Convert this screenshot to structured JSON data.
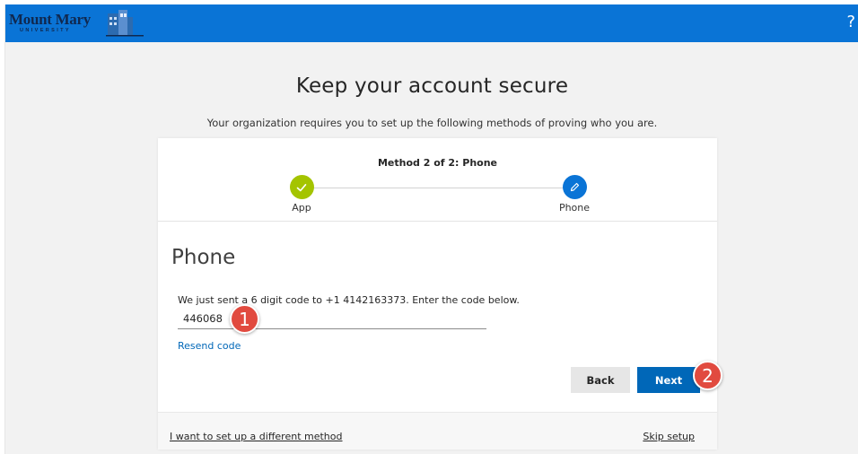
{
  "header": {
    "logo_text": "Mount Mary",
    "logo_subtext": "UNIVERSITY",
    "help_label": "?"
  },
  "page": {
    "title": "Keep your account secure",
    "subtitle": "Your organization requires you to set up the following methods of proving who you are."
  },
  "progress": {
    "method_label": "Method 2 of 2: Phone",
    "steps": [
      {
        "label": "App",
        "status": "complete",
        "color": "#a4c400",
        "icon": "checkmark-icon"
      },
      {
        "label": "Phone",
        "status": "current",
        "color": "#0a74d6",
        "icon": "pencil-icon"
      }
    ]
  },
  "phone_section": {
    "title": "Phone",
    "instructions": "We just sent a 6 digit code to +1 4142163373. Enter the code below.",
    "code_value": "446068",
    "resend_label": "Resend code"
  },
  "buttons": {
    "back_label": "Back",
    "next_label": "Next"
  },
  "footer": {
    "different_method_label": "I want to set up a different method",
    "skip_label": "Skip setup"
  },
  "callouts": {
    "one": "1",
    "two": "2",
    "color": "#e14a3f"
  },
  "colors": {
    "header_bg": "#0a74d6",
    "primary_button": "#0067b8",
    "link": "#0067b8"
  }
}
